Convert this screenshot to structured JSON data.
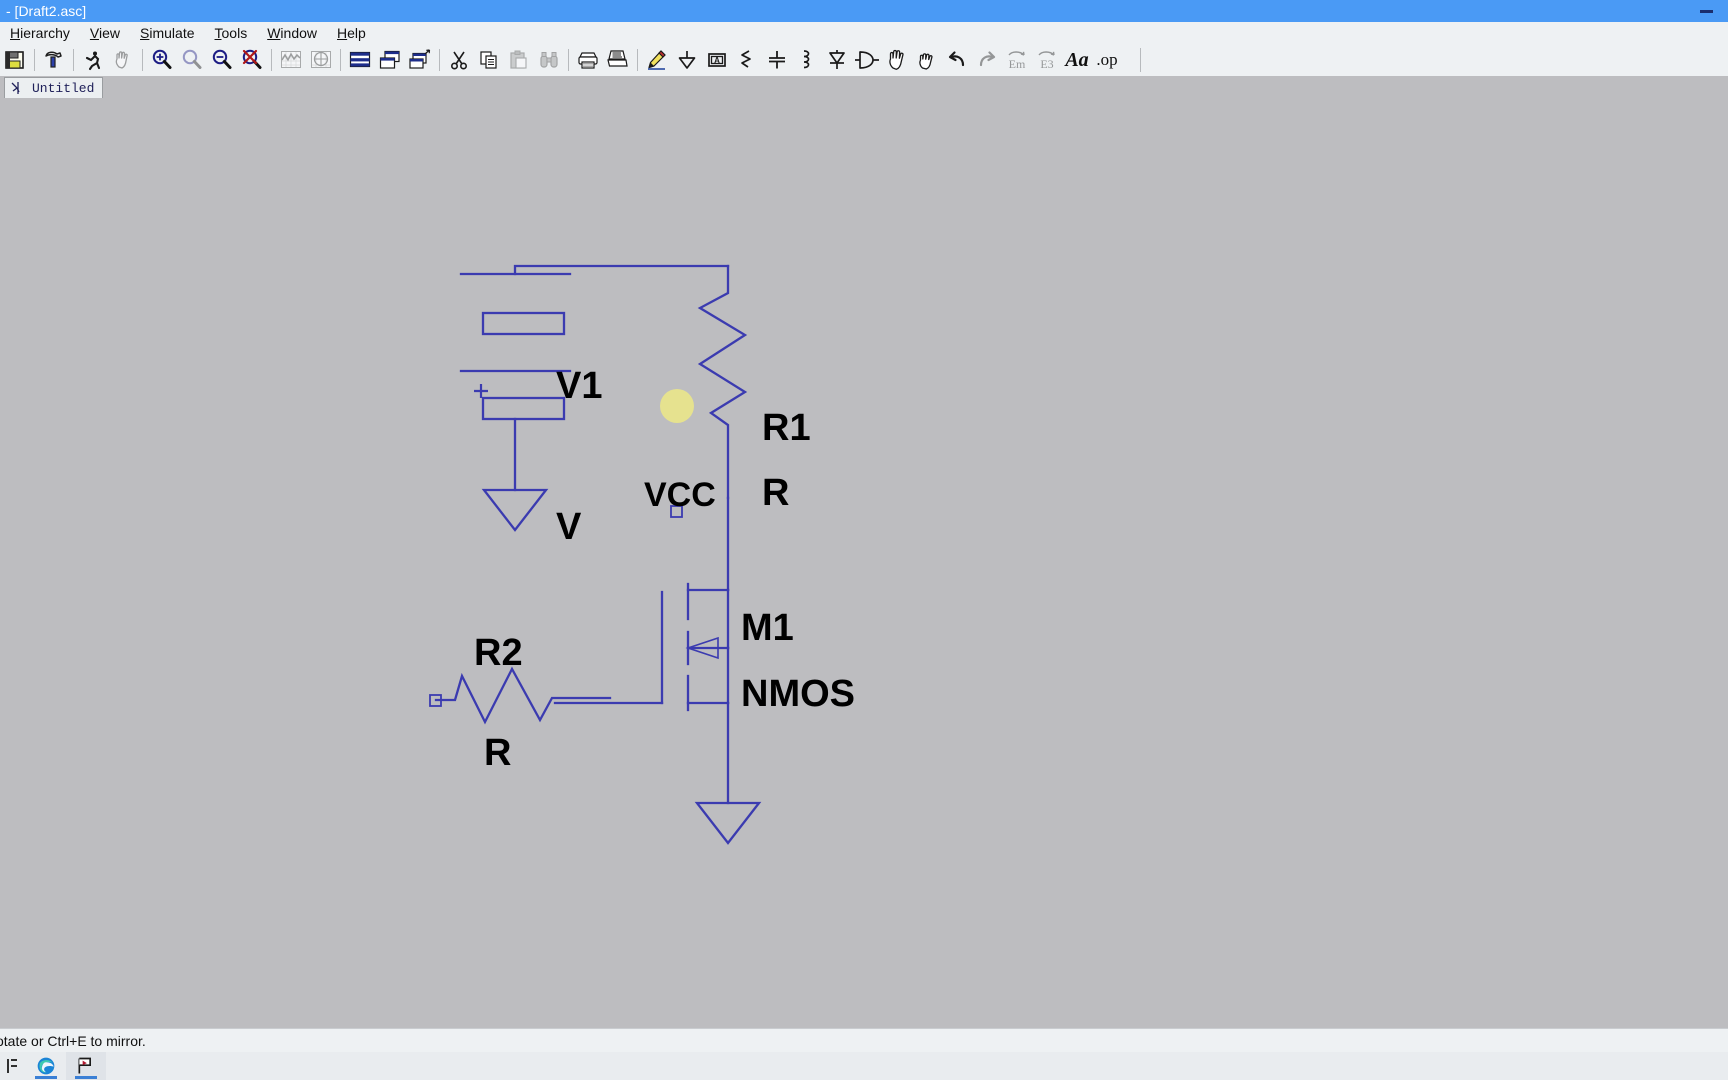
{
  "window": {
    "title": "- [Draft2.asc]",
    "minimize_label": "Minimize",
    "accent_titlebar": "#4a9af5"
  },
  "menu": {
    "items": [
      {
        "label": "Hierarchy",
        "accel": "H"
      },
      {
        "label": "View",
        "accel": "V"
      },
      {
        "label": "Simulate",
        "accel": "S"
      },
      {
        "label": "Tools",
        "accel": "T"
      },
      {
        "label": "Window",
        "accel": "W"
      },
      {
        "label": "Help",
        "accel": "H"
      }
    ]
  },
  "toolbar": {
    "items": [
      {
        "name": "save-icon",
        "tooltip": "Save",
        "enabled": true
      },
      {
        "name": "run-hammer-icon",
        "tooltip": "Run",
        "enabled": true
      },
      {
        "name": "stop-runner-icon",
        "tooltip": "Halt",
        "enabled": true
      },
      {
        "name": "pan-hand-icon",
        "tooltip": "Pan",
        "enabled": false
      },
      {
        "name": "zoom-in-icon",
        "tooltip": "Zoom In",
        "enabled": true
      },
      {
        "name": "zoom-area-icon",
        "tooltip": "Zoom Area",
        "enabled": false
      },
      {
        "name": "zoom-out-icon",
        "tooltip": "Zoom Out",
        "enabled": true
      },
      {
        "name": "zoom-full-extents-icon",
        "tooltip": "Zoom to Fit",
        "enabled": true
      },
      {
        "name": "waveform-icon",
        "tooltip": "Waveform",
        "enabled": false
      },
      {
        "name": "smith-chart-icon",
        "tooltip": "Smith Chart",
        "enabled": false
      },
      {
        "name": "spice-netlist-icon",
        "tooltip": "SPICE Netlist",
        "enabled": true
      },
      {
        "name": "tile-horizontal-icon",
        "tooltip": "Tile Horizontally",
        "enabled": true
      },
      {
        "name": "tile-vertical-icon",
        "tooltip": "Tile Vertically",
        "enabled": true
      },
      {
        "name": "cut-scissors-icon",
        "tooltip": "Cut",
        "enabled": true
      },
      {
        "name": "copy-icon",
        "tooltip": "Copy",
        "enabled": true
      },
      {
        "name": "paste-icon",
        "tooltip": "Paste",
        "enabled": false
      },
      {
        "name": "find-binoculars-icon",
        "tooltip": "Find",
        "enabled": false
      },
      {
        "name": "print-preview-icon",
        "tooltip": "Print Preview",
        "enabled": true
      },
      {
        "name": "print-icon",
        "tooltip": "Print",
        "enabled": true
      },
      {
        "name": "draw-wire-pencil-icon",
        "tooltip": "Draw Wire",
        "enabled": true
      },
      {
        "name": "ground-icon",
        "tooltip": "Place GND",
        "enabled": true
      },
      {
        "name": "label-net-icon",
        "tooltip": "Label Net",
        "enabled": true
      },
      {
        "name": "resistor-icon",
        "tooltip": "Resistor",
        "enabled": true
      },
      {
        "name": "capacitor-icon",
        "tooltip": "Capacitor",
        "enabled": true
      },
      {
        "name": "inductor-icon",
        "tooltip": "Inductor",
        "enabled": true
      },
      {
        "name": "diode-icon",
        "tooltip": "Diode",
        "enabled": true
      },
      {
        "name": "component-icon",
        "tooltip": "Component",
        "enabled": true
      },
      {
        "name": "move-hand-icon",
        "tooltip": "Move",
        "enabled": true
      },
      {
        "name": "drag-hand-icon",
        "tooltip": "Drag",
        "enabled": true
      },
      {
        "name": "undo-icon",
        "tooltip": "Undo",
        "enabled": true
      },
      {
        "name": "redo-icon",
        "tooltip": "Redo",
        "enabled": false
      },
      {
        "name": "rotate-icon",
        "tooltip": "Rotate",
        "enabled": false
      },
      {
        "name": "mirror-icon",
        "tooltip": "Mirror",
        "enabled": false
      },
      {
        "name": "text-aa-icon",
        "tooltip": "Text",
        "enabled": true
      },
      {
        "name": "spice-directive-op-icon",
        "tooltip": "SPICE Directive",
        "enabled": true
      }
    ],
    "text_label": "Aa",
    "op_label": ".op"
  },
  "tabs": [
    {
      "label": "Untitled",
      "icon": "schematic-icon",
      "active": true
    }
  ],
  "schematic": {
    "labels": {
      "v1_name": "V1",
      "v1_value": "V",
      "r1_name": "R1",
      "r1_value": "R",
      "r2_name": "R2",
      "r2_value": "R",
      "m1_name": "M1",
      "m1_value": "NMOS",
      "net_vcc": "VCC"
    },
    "wire_color": "#3b3bb0",
    "text_color": "#000000",
    "background": "#bdbdc0",
    "cursor_highlight_color": "#f0eb82"
  },
  "status": {
    "message": "otate or Ctrl+E to mirror."
  },
  "taskbar": {
    "items": [
      {
        "name": "start-icon",
        "label": "Start"
      },
      {
        "name": "edge-browser-icon",
        "label": "Microsoft Edge"
      },
      {
        "name": "ltspice-icon",
        "label": "LTspice"
      }
    ]
  }
}
